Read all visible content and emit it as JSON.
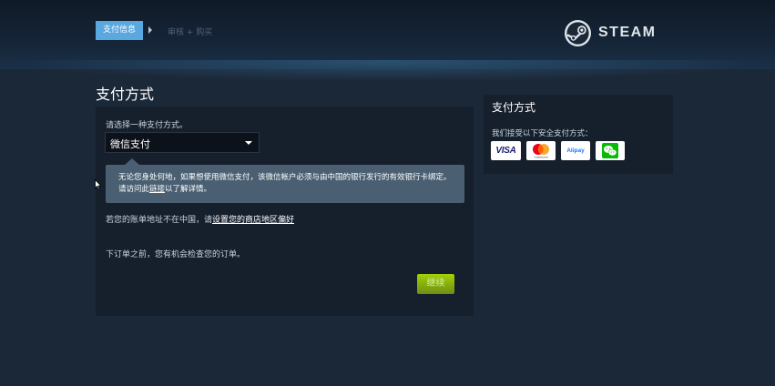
{
  "header": {
    "steps": [
      {
        "label": "支付信息",
        "active": true
      },
      {
        "label": "审核 + 购买",
        "active": false
      }
    ],
    "brand": "STEAM"
  },
  "page": {
    "title": "支付方式"
  },
  "payment_form": {
    "select_prompt": "请选择一种支付方式。",
    "selected_method": "微信支付",
    "notice_text_before_link": "无论您身处何地，如果想使用微信支付，该微信帐户必须与由中国的银行发行的有效银行卡绑定。请访问此",
    "notice_link": "链接",
    "notice_text_after_link": "以了解详情。",
    "country_text": "若您的账单地址不在中国，请",
    "country_link": "设置您的商店地区偏好",
    "review_text": "下订单之前，您有机会检查您的订单。",
    "continue_label": "继续"
  },
  "sidebar": {
    "title": "支付方式",
    "subtitle": "我们接受以下安全支付方式：",
    "methods": [
      {
        "name": "visa-card-icon",
        "text": "VISA"
      },
      {
        "name": "mastercard-icon",
        "text": "mastercard"
      },
      {
        "name": "alipay-icon",
        "text": "Alipay"
      },
      {
        "name": "wechat-pay-icon",
        "text": ""
      }
    ]
  },
  "colors": {
    "background": "#1b2838",
    "active_step": "#59a8e0",
    "panel": "#16202d",
    "notice": "#4a6072",
    "continue_button": "#6b8e13"
  }
}
